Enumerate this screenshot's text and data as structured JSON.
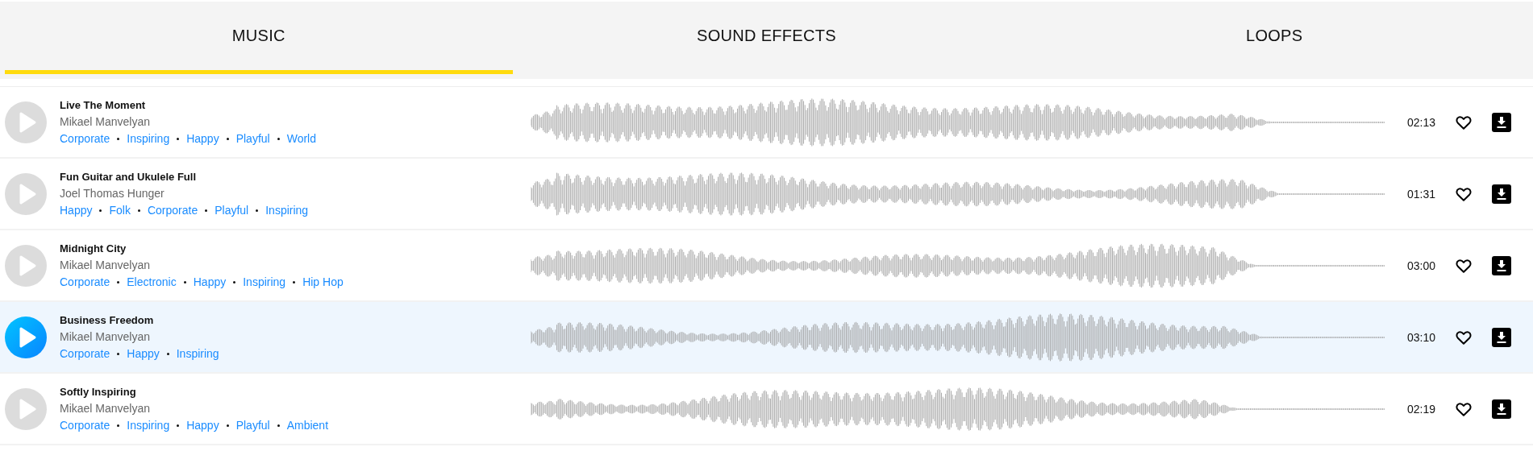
{
  "tabs": [
    {
      "label": "MUSIC",
      "selected": true
    },
    {
      "label": "SOUND EFFECTS",
      "selected": false
    },
    {
      "label": "LOOPS",
      "selected": false
    }
  ],
  "tracks": [
    {
      "title": "Live The Moment",
      "artist": "Mikael Manvelyan",
      "tags": [
        "Corporate",
        "Inspiring",
        "Happy",
        "Playful",
        "World"
      ],
      "duration": "02:13",
      "selected": false
    },
    {
      "title": "Fun Guitar and Ukulele Full",
      "artist": "Joel Thomas Hunger",
      "tags": [
        "Happy",
        "Folk",
        "Corporate",
        "Playful",
        "Inspiring"
      ],
      "duration": "01:31",
      "selected": false
    },
    {
      "title": "Midnight City",
      "artist": "Mikael Manvelyan",
      "tags": [
        "Corporate",
        "Electronic",
        "Happy",
        "Inspiring",
        "Hip Hop"
      ],
      "duration": "03:00",
      "selected": false
    },
    {
      "title": "Business Freedom",
      "artist": "Mikael Manvelyan",
      "tags": [
        "Corporate",
        "Happy",
        "Inspiring"
      ],
      "duration": "03:10",
      "selected": true
    },
    {
      "title": "Softly Inspiring",
      "artist": "Mikael Manvelyan",
      "tags": [
        "Corporate",
        "Inspiring",
        "Happy",
        "Playful",
        "Ambient"
      ],
      "duration": "02:19",
      "selected": false
    }
  ]
}
